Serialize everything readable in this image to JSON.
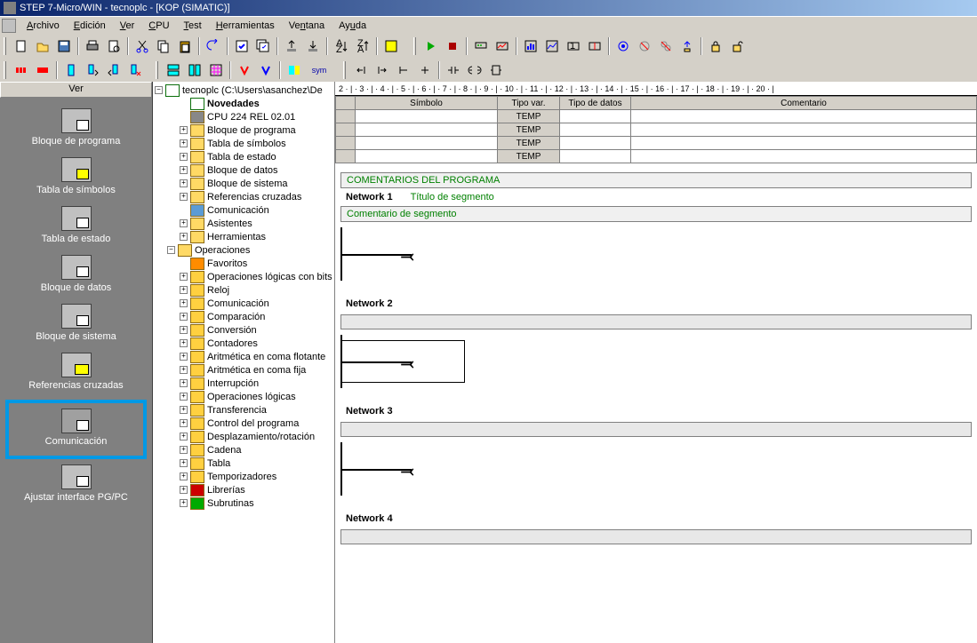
{
  "title": "STEP 7-Micro/WIN - tecnoplc - [KOP (SIMATIC)]",
  "menu": [
    "Archivo",
    "Edición",
    "Ver",
    "CPU",
    "Test",
    "Herramientas",
    "Ventana",
    "Ayuda"
  ],
  "menu_accel": [
    "A",
    "E",
    "V",
    "C",
    "T",
    "H",
    "n",
    "u"
  ],
  "nav_header": "Ver",
  "nav_items": [
    {
      "label": "Bloque de programa"
    },
    {
      "label": "Tabla de símbolos"
    },
    {
      "label": "Tabla de estado"
    },
    {
      "label": "Bloque de datos"
    },
    {
      "label": "Bloque de sistema"
    },
    {
      "label": "Referencias cruzadas"
    },
    {
      "label": "Comunicación",
      "highlight": true
    },
    {
      "label": "Ajustar interface PG/PC"
    }
  ],
  "tree": {
    "root": "tecnoplc (C:\\Users\\asanchez\\De",
    "children": [
      {
        "label": "Novedades",
        "bold": true,
        "icon": "root",
        "exp": ""
      },
      {
        "label": "CPU 224 REL 02.01",
        "icon": "cpu",
        "exp": ""
      },
      {
        "label": "Bloque de programa",
        "exp": "+",
        "icon": ""
      },
      {
        "label": "Tabla de símbolos",
        "exp": "+",
        "icon": ""
      },
      {
        "label": "Tabla de estado",
        "exp": "+",
        "icon": ""
      },
      {
        "label": "Bloque de datos",
        "exp": "+",
        "icon": ""
      },
      {
        "label": "Bloque de sistema",
        "exp": "+",
        "icon": ""
      },
      {
        "label": "Referencias cruzadas",
        "exp": "+",
        "icon": ""
      },
      {
        "label": "Comunicación",
        "exp": "",
        "icon": "blue"
      },
      {
        "label": "Asistentes",
        "exp": "+",
        "icon": ""
      },
      {
        "label": "Herramientas",
        "exp": "+",
        "icon": ""
      }
    ],
    "operations": {
      "label": "Operaciones",
      "children": [
        {
          "label": "Favoritos",
          "icon": "fav",
          "exp": ""
        },
        {
          "label": "Operaciones lógicas con bits",
          "exp": "+",
          "icon": "op"
        },
        {
          "label": "Reloj",
          "exp": "+",
          "icon": "op"
        },
        {
          "label": "Comunicación",
          "exp": "+",
          "icon": "op"
        },
        {
          "label": "Comparación",
          "exp": "+",
          "icon": "op"
        },
        {
          "label": "Conversión",
          "exp": "+",
          "icon": "op"
        },
        {
          "label": "Contadores",
          "exp": "+",
          "icon": "op"
        },
        {
          "label": "Aritmética en coma flotante",
          "exp": "+",
          "icon": "op"
        },
        {
          "label": "Aritmética en coma fija",
          "exp": "+",
          "icon": "op"
        },
        {
          "label": "Interrupción",
          "exp": "+",
          "icon": "op"
        },
        {
          "label": "Operaciones lógicas",
          "exp": "+",
          "icon": "op"
        },
        {
          "label": "Transferencia",
          "exp": "+",
          "icon": "op"
        },
        {
          "label": "Control del programa",
          "exp": "+",
          "icon": "op"
        },
        {
          "label": "Desplazamiento/rotación",
          "exp": "+",
          "icon": "op"
        },
        {
          "label": "Cadena",
          "exp": "+",
          "icon": "op"
        },
        {
          "label": "Tabla",
          "exp": "+",
          "icon": "op"
        },
        {
          "label": "Temporizadores",
          "exp": "+",
          "icon": "op"
        },
        {
          "label": "Librerías",
          "exp": "+",
          "icon": "red"
        },
        {
          "label": "Subrutinas",
          "exp": "+",
          "icon": "green"
        }
      ]
    }
  },
  "ruler_text": "2 · | · 3 · | · 4 · | · 5 · | · 6 · | · 7 · | · 8 · | · 9 · | · 10 · | · 11 · | · 12 · | · 13 · | · 14 · | · 15 · | · 16 · | · 17 · | · 18 · | · 19 · | · 20 · |",
  "var_table": {
    "headers": [
      "",
      "Símbolo",
      "Tipo var.",
      "Tipo de datos",
      "Comentario"
    ],
    "rows": [
      {
        "tipo": "TEMP"
      },
      {
        "tipo": "TEMP"
      },
      {
        "tipo": "TEMP"
      },
      {
        "tipo": "TEMP"
      }
    ]
  },
  "program": {
    "comment_header": "COMENTARIOS DEL PROGRAMA",
    "networks": [
      {
        "title": "Network 1",
        "seg": "Título de segmento",
        "comment": "Comentario de segmento",
        "box": false
      },
      {
        "title": "Network 2",
        "seg": "",
        "comment": "",
        "box": true
      },
      {
        "title": "Network 3",
        "seg": "",
        "comment": "",
        "box": false
      },
      {
        "title": "Network 4",
        "seg": "",
        "comment": "",
        "box": false,
        "noladder": true
      }
    ]
  }
}
